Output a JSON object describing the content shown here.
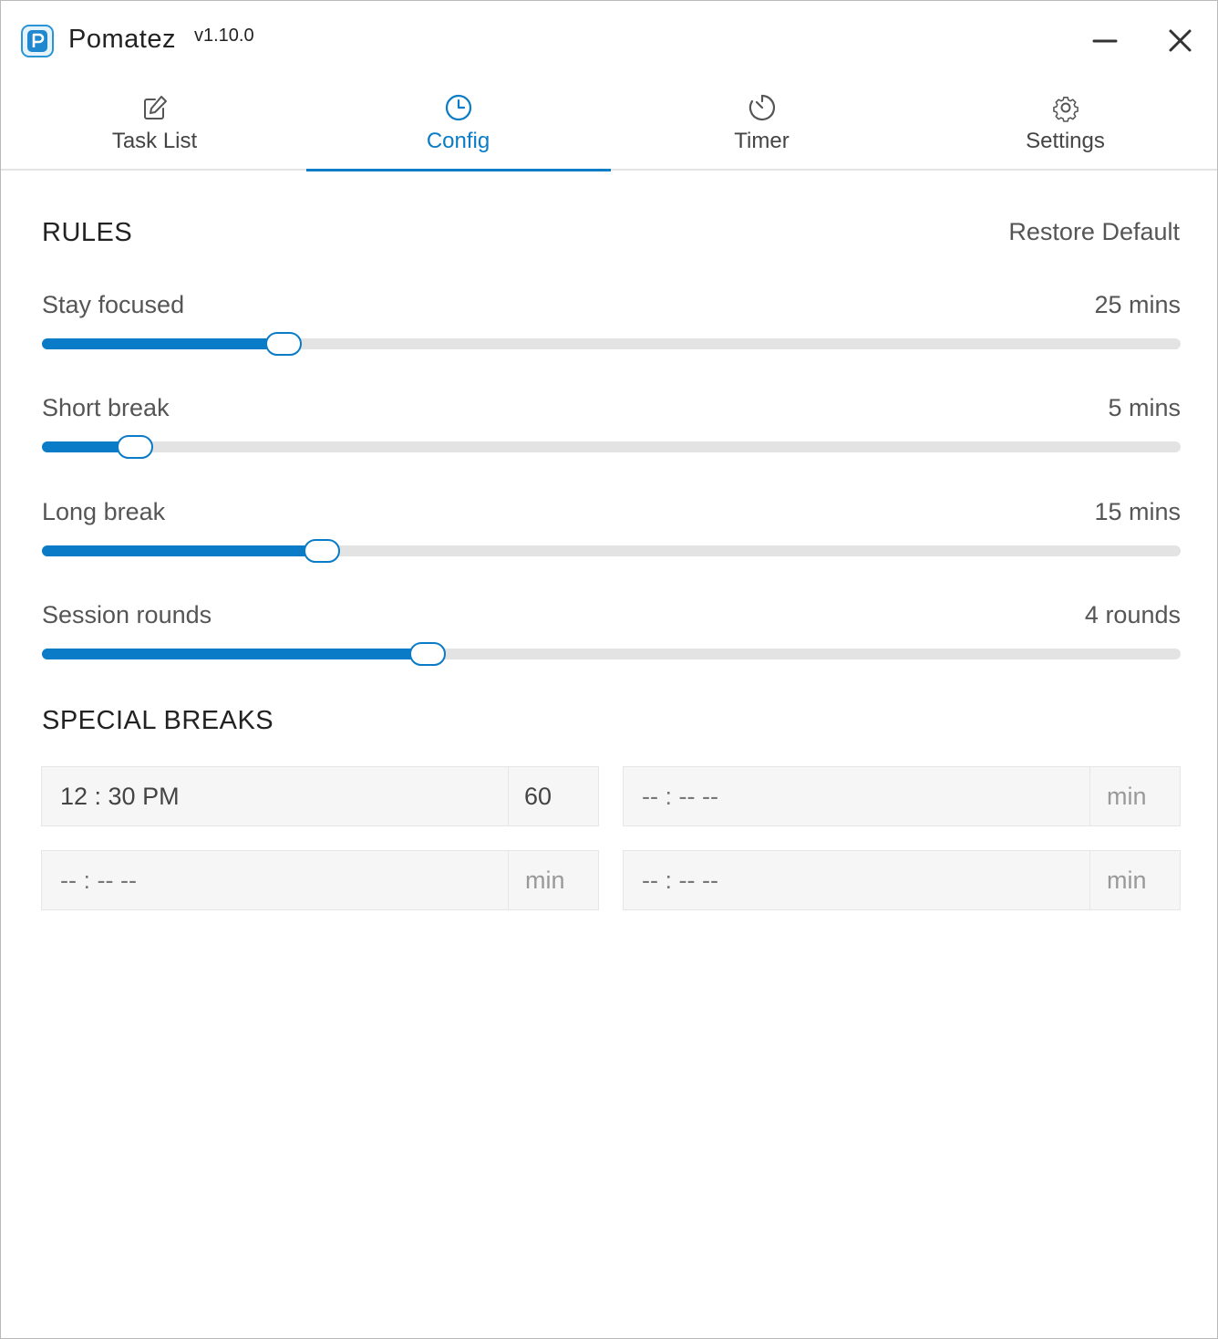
{
  "app": {
    "name": "Pomatez",
    "version": "v1.10.0",
    "logo_letter": "P"
  },
  "nav": {
    "tabs": [
      {
        "label": "Task List",
        "icon": "edit-icon",
        "active": false
      },
      {
        "label": "Config",
        "icon": "clock-icon",
        "active": true
      },
      {
        "label": "Timer",
        "icon": "timer-icon",
        "active": false
      },
      {
        "label": "Settings",
        "icon": "gear-icon",
        "active": false
      }
    ]
  },
  "rules": {
    "heading": "RULES",
    "restore_label": "Restore Default",
    "sliders": [
      {
        "label": "Stay focused",
        "value_text": "25 mins",
        "fraction": 0.212
      },
      {
        "label": "Short break",
        "value_text": "5 mins",
        "fraction": 0.082
      },
      {
        "label": "Long break",
        "value_text": "15 mins",
        "fraction": 0.246
      },
      {
        "label": "Session rounds",
        "value_text": "4 rounds",
        "fraction": 0.339
      }
    ]
  },
  "special_breaks": {
    "heading": "SPECIAL BREAKS",
    "entries": [
      {
        "time": "12 : 30   PM",
        "duration": "60",
        "time_placeholder": false,
        "duration_placeholder": false
      },
      {
        "time": "-- : --   --",
        "duration": "min",
        "time_placeholder": true,
        "duration_placeholder": true
      },
      {
        "time": "-- : --   --",
        "duration": "min",
        "time_placeholder": true,
        "duration_placeholder": true
      },
      {
        "time": "-- : --   --",
        "duration": "min",
        "time_placeholder": true,
        "duration_placeholder": true
      }
    ]
  },
  "colors": {
    "accent": "#0a7bc6",
    "track": "#e3e3e3",
    "input_bg": "#f6f6f6"
  }
}
